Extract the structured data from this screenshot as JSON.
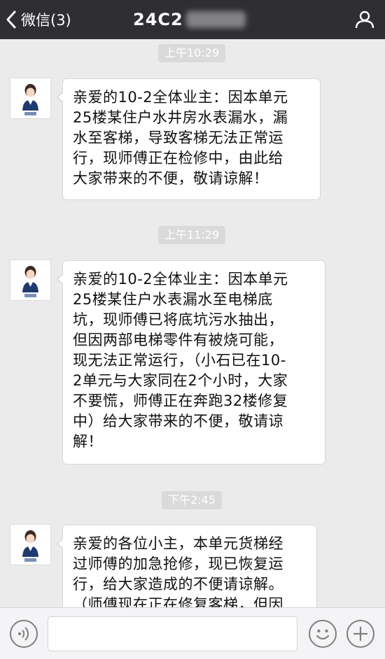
{
  "header": {
    "back_label": "微信(3)",
    "title": "24C2"
  },
  "messages": [
    {
      "time": "上午10:29",
      "lines": [
        "亲爱的10-2全体业主：因本单元",
        "25楼某住户水井房水表漏水，漏",
        "水至客梯，导致客梯无法正常运",
        "行，现师傅正在检修中，由此给",
        "大家带来的不便，敬请谅解！"
      ]
    },
    {
      "time": "上午11:29",
      "lines": [
        "亲爱的10-2全体业主：因本单元",
        "25楼某住户水表漏水至电梯底",
        "坑，现师傅已将底坑污水抽出，",
        "但因两部电梯零件有被烧可能，",
        "现无法正常运行，（小石已在10-",
        "2单元与大家同在2个小时，大家",
        "不要慌，师傅正在奔跑32楼修复",
        "中）给大家带来的不便，敬请谅",
        "解！"
      ]
    },
    {
      "time": "下午2:45",
      "lines": [
        "亲爱的各位小主，本单元货梯经",
        "过师傅的加急抢修，现已恢复运",
        "行，给大家造成的不便请谅解。",
        "（师傅现在正在修复客梯，但因"
      ]
    }
  ],
  "icons": {
    "back": "chevron-left-icon",
    "profile": "person-icon",
    "voice": "voice-icon",
    "emoji": "smile-icon",
    "more": "plus-icon"
  },
  "colors": {
    "topbar": "#2e2e33",
    "background": "#ebebeb",
    "bubble": "#ffffff",
    "timestamp_bg": "#dadada"
  }
}
